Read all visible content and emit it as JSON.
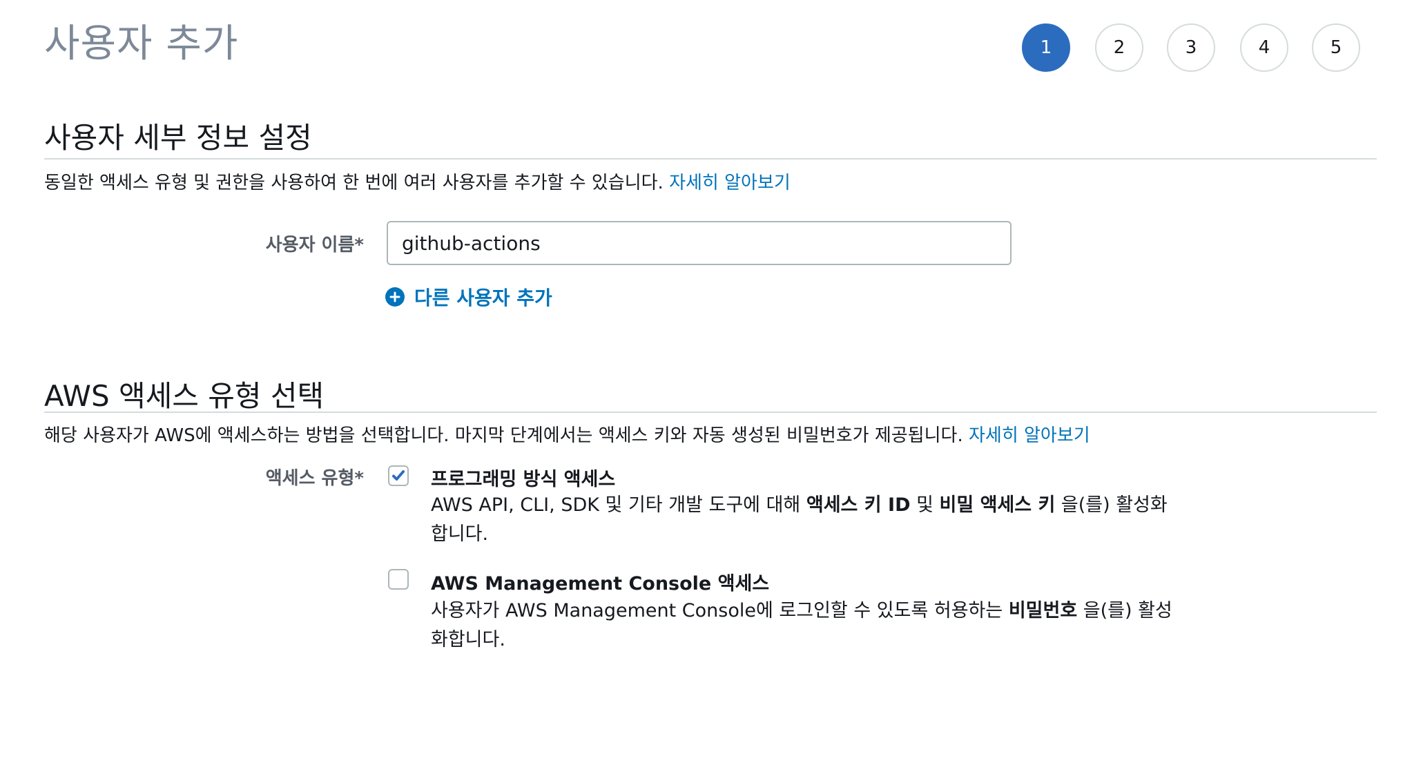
{
  "page_title": "사용자 추가",
  "steps": [
    {
      "label": "1",
      "active": true
    },
    {
      "label": "2",
      "active": false
    },
    {
      "label": "3",
      "active": false
    },
    {
      "label": "4",
      "active": false
    },
    {
      "label": "5",
      "active": false
    }
  ],
  "details": {
    "title": "사용자 세부 정보 설정",
    "description": "동일한 액세스 유형 및 권한을 사용하여 한 번에 여러 사용자를 추가할 수 있습니다.",
    "learn_more": "자세히 알아보기",
    "username_label": "사용자 이름*",
    "username_value": "github-actions",
    "add_user_label": "다른 사용자 추가"
  },
  "access": {
    "title": "AWS 액세스 유형 선택",
    "description": "해당 사용자가 AWS에 액세스하는 방법을 선택합니다. 마지막 단계에서는 액세스 키와 자동 생성된 비밀번호가 제공됩니다.",
    "learn_more": "자세히 알아보기",
    "type_label": "액세스 유형*",
    "programmatic": {
      "title": "프로그래밍 방식 액세스",
      "checked": true,
      "desc_prefix": "AWS API, CLI, SDK 및 기타 개발 도구에 대해 ",
      "desc_bold1": "액세스 키 ID",
      "desc_mid": " 및 ",
      "desc_bold2": "비밀 액세스 키",
      "desc_suffix": " 을(를) 활성화합니다."
    },
    "console": {
      "title": "AWS Management Console 액세스",
      "checked": false,
      "desc_prefix": "사용자가 AWS Management Console에 로그인할 수 있도록 허용하는 ",
      "desc_bold": "비밀번호",
      "desc_suffix": " 을(를) 활성화합니다."
    }
  },
  "colors": {
    "accent": "#2c6cbf",
    "link": "#0073bb",
    "muted_title": "#7d8998"
  }
}
